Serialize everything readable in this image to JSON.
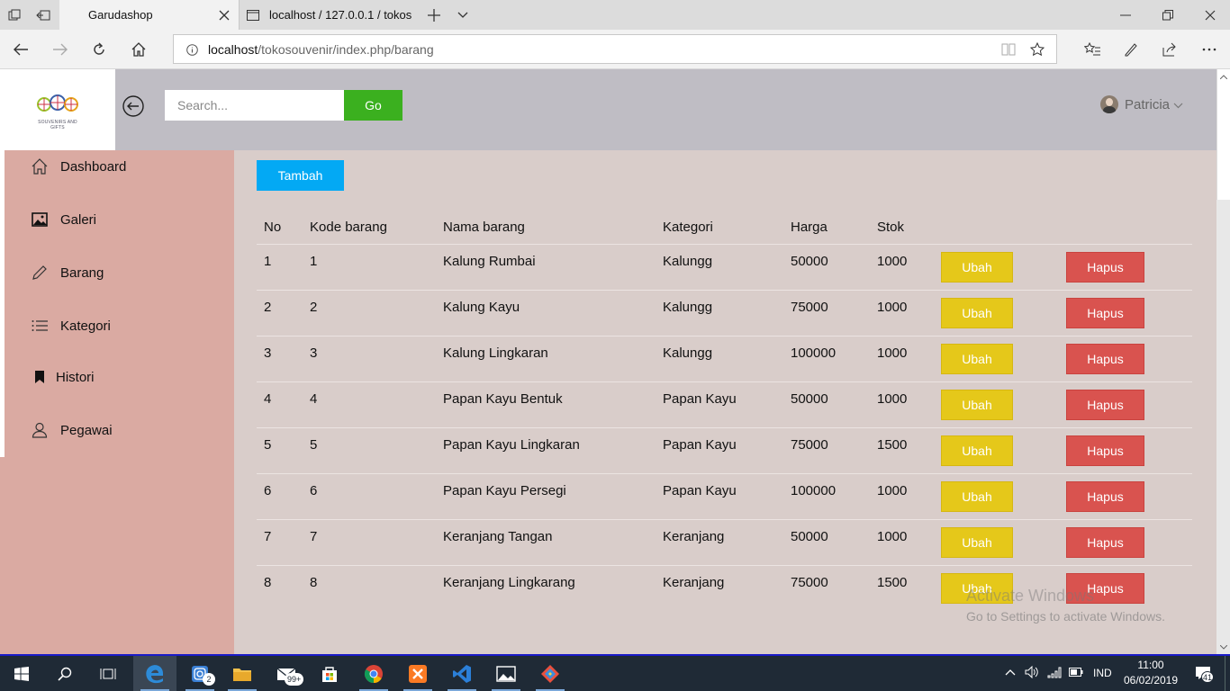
{
  "browser": {
    "tabs": [
      {
        "title": "Garudashop"
      },
      {
        "title": "localhost / 127.0.0.1 / tokos"
      }
    ],
    "url_host": "localhost",
    "url_path": "/tokosouvenir/index.php/barang"
  },
  "app": {
    "search_placeholder": "Search...",
    "go_label": "Go",
    "user_name": "Patricia",
    "logo_text": "SOUVENIRS AND GIFTS"
  },
  "sidebar": {
    "items": [
      {
        "label": "Dashboard",
        "icon": "home-icon"
      },
      {
        "label": "Galeri",
        "icon": "image-icon"
      },
      {
        "label": "Barang",
        "icon": "pencil-icon"
      },
      {
        "label": "Kategori",
        "icon": "list-icon"
      },
      {
        "label": "Histori",
        "icon": "bookmark-icon"
      },
      {
        "label": "Pegawai",
        "icon": "user-icon"
      }
    ]
  },
  "main": {
    "add_label": "Tambah",
    "columns": [
      "No",
      "Kode barang",
      "Nama barang",
      "Kategori",
      "Harga",
      "Stok"
    ],
    "edit_label": "Ubah",
    "delete_label": "Hapus",
    "rows": [
      {
        "no": "1",
        "kode": "1",
        "nama": "Kalung Rumbai",
        "kategori": "Kalungg",
        "harga": "50000",
        "stok": "1000"
      },
      {
        "no": "2",
        "kode": "2",
        "nama": "Kalung Kayu",
        "kategori": "Kalungg",
        "harga": "75000",
        "stok": "1000"
      },
      {
        "no": "3",
        "kode": "3",
        "nama": "Kalung Lingkaran",
        "kategori": "Kalungg",
        "harga": "100000",
        "stok": "1000"
      },
      {
        "no": "4",
        "kode": "4",
        "nama": "Papan Kayu Bentuk",
        "kategori": "Papan Kayu",
        "harga": "50000",
        "stok": "1000"
      },
      {
        "no": "5",
        "kode": "5",
        "nama": "Papan Kayu Lingkaran",
        "kategori": "Papan Kayu",
        "harga": "75000",
        "stok": "1500"
      },
      {
        "no": "6",
        "kode": "6",
        "nama": "Papan Kayu Persegi",
        "kategori": "Papan Kayu",
        "harga": "100000",
        "stok": "1000"
      },
      {
        "no": "7",
        "kode": "7",
        "nama": "Keranjang Tangan",
        "kategori": "Keranjang",
        "harga": "50000",
        "stok": "1000"
      },
      {
        "no": "8",
        "kode": "8",
        "nama": "Keranjang Lingkarang",
        "kategori": "Keranjang",
        "harga": "75000",
        "stok": "1500"
      }
    ]
  },
  "watermark": {
    "line1": "Activate Windows",
    "line2": "Go to Settings to activate Windows."
  },
  "taskbar": {
    "time": "11:00",
    "date": "06/02/2019",
    "lang": "IND",
    "notif_count": "41",
    "instagram_badge": "2",
    "mail_badge": "99+"
  },
  "colors": {
    "topbar": "#bfbdc4",
    "sidebar": "#daaaa2",
    "main": "#d9cdca",
    "go": "#3bb01f",
    "tambah": "#03a9f4",
    "ubah": "#e5c81a",
    "hapus": "#d9534f"
  }
}
